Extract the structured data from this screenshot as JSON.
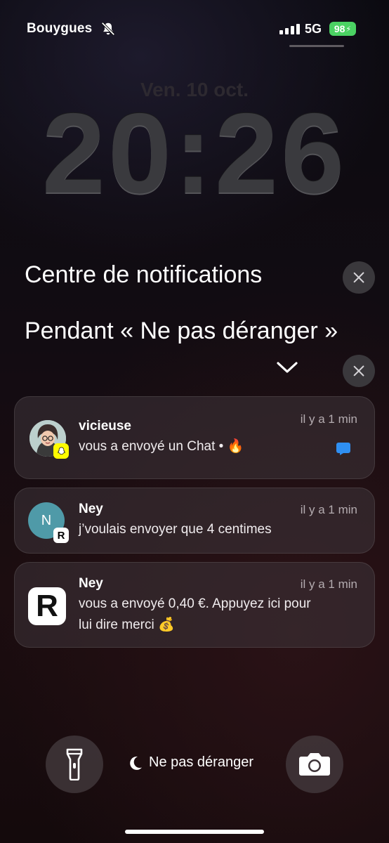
{
  "status_bar": {
    "carrier": "Bouygues",
    "network": "5G",
    "battery": "98",
    "battery_color": "#4bd263",
    "silent_icon": "bell-slash-icon"
  },
  "lock": {
    "date": "Ven. 10 oct.",
    "time": "20:26"
  },
  "notification_center": {
    "title": "Centre de notifications",
    "dnd_section_title": "Pendant « Ne pas déranger »"
  },
  "notifications": [
    {
      "app": "Snapchat",
      "sender": "vicieuse",
      "time": "il y a 1 min",
      "message": "vous a envoyé un Chat • 🔥",
      "accent": "#2f8ff2"
    },
    {
      "app": "Revolut",
      "sender": "Ney",
      "avatar_initial": "N",
      "time": "il y a 1 min",
      "message": "j’voulais envoyer que 4 centimes"
    },
    {
      "app": "Revolut",
      "sender": "Ney",
      "time": "il y a 1 min",
      "message_line1": "vous a envoyé 0,40 €. Appuyez ici pour",
      "message_line2": "lui dire merci 💰"
    }
  ],
  "bottom": {
    "focus_label": "Ne pas déranger",
    "flashlight_icon": "flashlight-icon",
    "camera_icon": "camera-icon"
  }
}
